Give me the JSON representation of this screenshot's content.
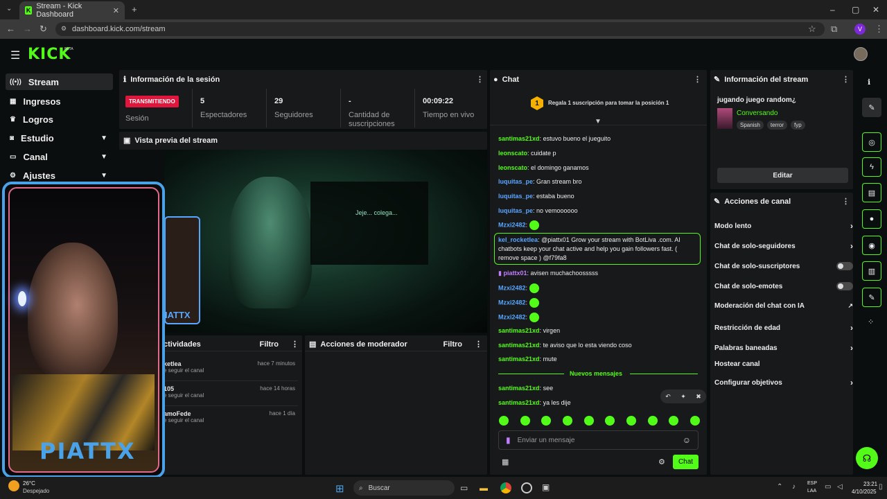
{
  "browser": {
    "tab_title": "Stream - Kick Dashboard",
    "url": "dashboard.kick.com/stream",
    "profile_initial": "V"
  },
  "brand": {
    "logo": "KICK",
    "beta": "BETA",
    "accent": "#53fc18"
  },
  "sidebar": {
    "items": [
      {
        "label": "Stream",
        "icon": "signal-icon"
      },
      {
        "label": "Ingresos",
        "icon": "chart-icon"
      },
      {
        "label": "Logros",
        "icon": "trophy-icon"
      },
      {
        "label": "Estudio",
        "icon": "camera-icon"
      },
      {
        "label": "Canal",
        "icon": "monitor-icon"
      },
      {
        "label": "Ajustes",
        "icon": "gear-icon"
      }
    ]
  },
  "session": {
    "title": "Información de la sesión",
    "status": "TRANSMITIENDO",
    "status_label": "Sesión",
    "stats": [
      {
        "value": "5",
        "label": "Espectadores"
      },
      {
        "value": "29",
        "label": "Seguidores"
      },
      {
        "value": "-",
        "label": "Cantidad de suscripciones"
      },
      {
        "value": "00:09:22",
        "label": "Tiempo en vivo"
      }
    ]
  },
  "preview": {
    "title": "Vista previa del stream",
    "overlay_text": "Jeje... colega...",
    "streamer_name": "PIATTX",
    "small_name": "IATTX"
  },
  "activity": {
    "title": "ctividades",
    "filter": "Filtro",
    "items": [
      {
        "name": "ketlea",
        "action": "e seguir el canal",
        "time": "hace 7 minutos"
      },
      {
        "name": "105",
        "action": "e seguir el canal",
        "time": "hace 14 horas"
      },
      {
        "name": "amoFede",
        "action": "e seguir el canal",
        "time": "hace 1 día"
      }
    ]
  },
  "moderator": {
    "title": "Acciones de moderador",
    "filter": "Filtro"
  },
  "chat": {
    "title": "Chat",
    "gift_rank": "1",
    "gift_text": "Regala 1 suscripción para tomar la posición 1",
    "messages": [
      {
        "user": "santimas21xd",
        "text": "estuvo bueno el jueguito"
      },
      {
        "user": "leonscato",
        "text": "cuidate p"
      },
      {
        "user": "leonscato",
        "text": "el domingo ganamos"
      },
      {
        "user": "luquitas_pe",
        "text": "Gran stream bro"
      },
      {
        "user": "luquitas_pe",
        "text": "estaba bueno"
      },
      {
        "user": "luquitas_pe",
        "text": "no vemoooooo"
      }
    ],
    "emote_user": "Mzxi2482",
    "highlight": {
      "user": "kel_rocketlea",
      "text": "@piattx01 Grow your stream with BotLiva .com. AI chatbots keep your chat active and help you gain followers fast. ( remove space ) @f79fa8"
    },
    "sub_msg": {
      "user": "piattx01",
      "text": "avisen muchachoosssss"
    },
    "later": [
      {
        "user": "santimas21xd",
        "text": "virgen"
      },
      {
        "user": "santimas21xd",
        "text": "te aviso que lo esta viendo coso"
      },
      {
        "user": "santimas21xd",
        "text": "mute"
      }
    ],
    "new_messages": "Nuevos mensajes",
    "newest": [
      {
        "user": "santimas21xd",
        "text": "see"
      },
      {
        "user": "santimas21xd",
        "text": "ya les dije"
      }
    ],
    "input_placeholder": "Enviar un mensaje",
    "send": "Chat"
  },
  "stream_info": {
    "title": "Información del stream",
    "stream_title": "jugando juego random¿",
    "category": "Conversando",
    "tags": [
      "Spanish",
      "terror",
      "fyp"
    ],
    "edit": "Editar"
  },
  "channel_actions": {
    "title": "Acciones de canal",
    "rows": [
      {
        "label": "Modo lento",
        "kind": "chevron"
      },
      {
        "label": "Chat de solo-seguidores",
        "kind": "chevron"
      },
      {
        "label": "Chat de solo-suscriptores",
        "kind": "toggle"
      },
      {
        "label": "Chat de solo-emotes",
        "kind": "toggle"
      },
      {
        "label": "Moderación del chat con IA",
        "kind": "external"
      },
      {
        "label": "Restricción de edad",
        "kind": "chevron"
      },
      {
        "label": "Palabras baneadas",
        "kind": "chevron"
      },
      {
        "label": "Hostear canal",
        "kind": "none"
      },
      {
        "label": "Configurar objetivos",
        "kind": "chevron"
      }
    ]
  },
  "taskbar": {
    "weather_temp": "26°C",
    "weather_text": "Despejado",
    "search": "Buscar",
    "lang": "ESP",
    "lang2": "LAA",
    "time": "23:21",
    "date": "4/10/2025"
  }
}
